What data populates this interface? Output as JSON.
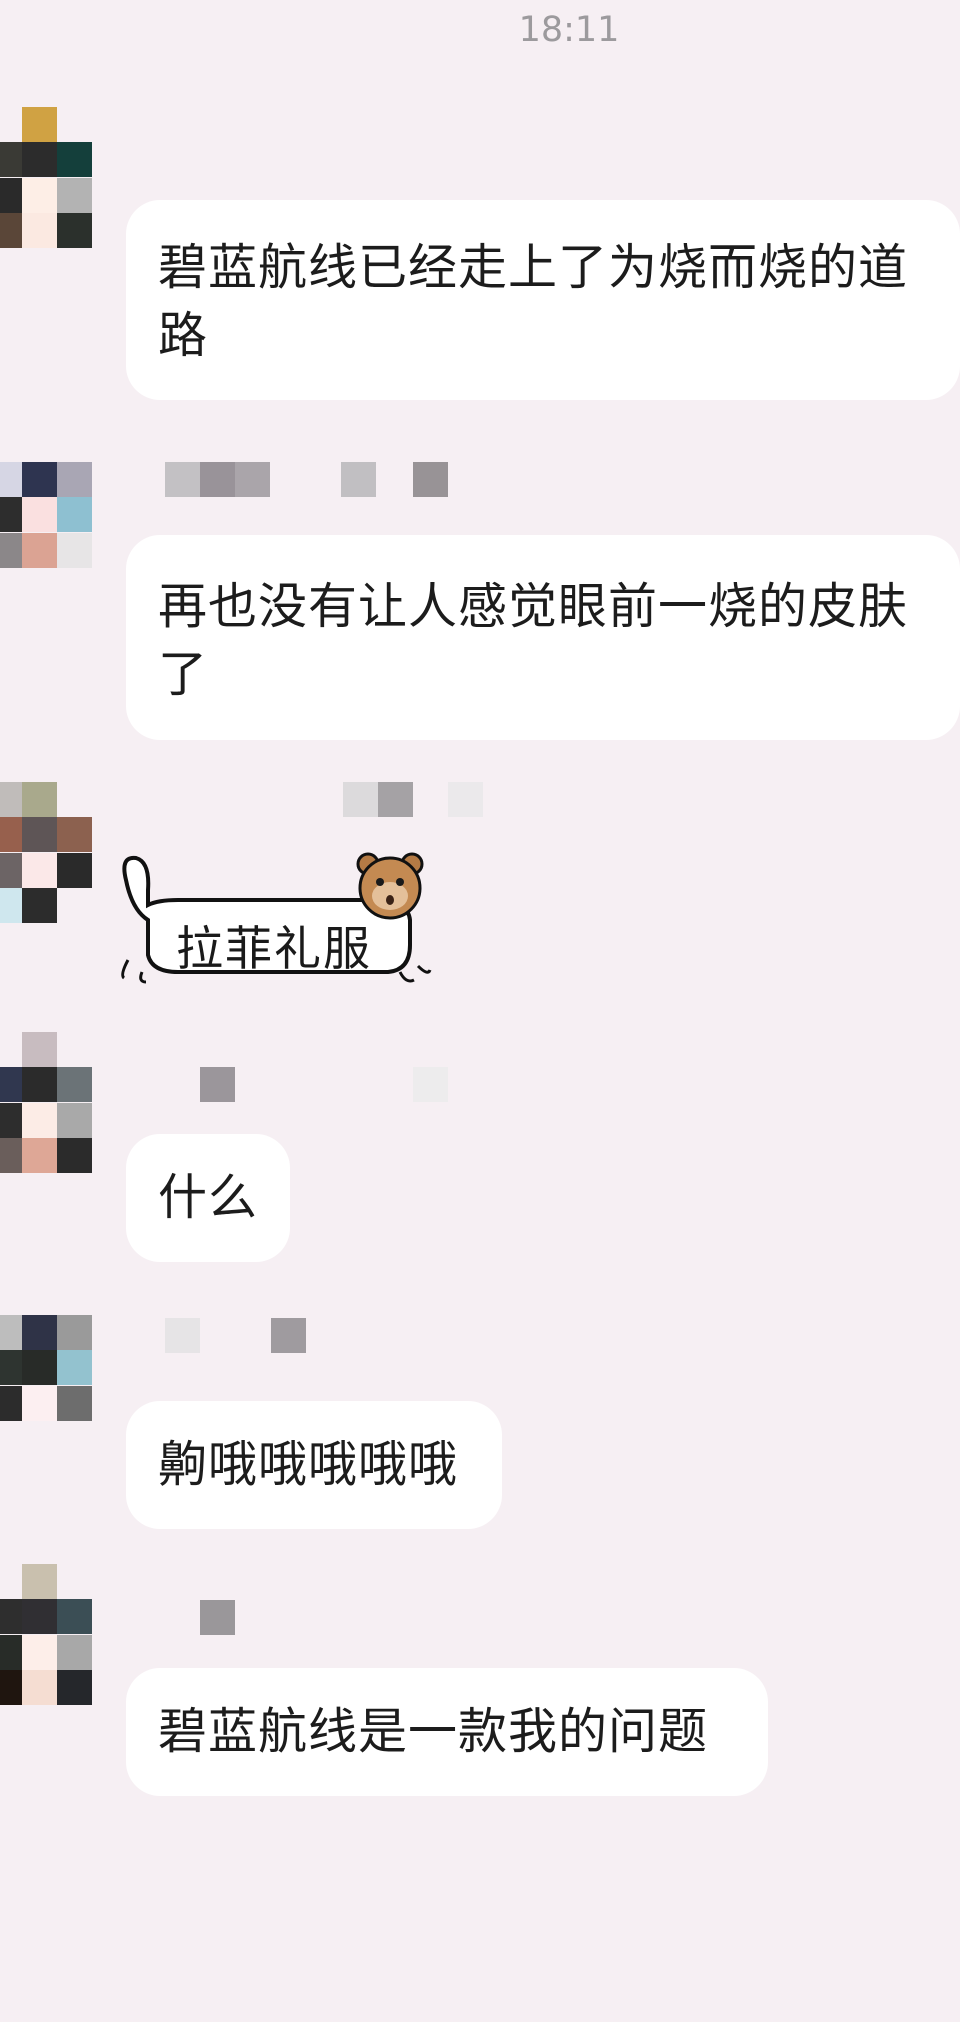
{
  "status_bar": {
    "time": "18:11"
  },
  "messages": [
    {
      "type": "text",
      "text": "碧蓝航线已经走上了为烧而烧的道\n路"
    },
    {
      "type": "text",
      "text": "再也没有让人感觉眼前一烧的皮肤\n了"
    },
    {
      "type": "sticker",
      "text": "拉菲礼服",
      "icon": "hamster-face-icon"
    },
    {
      "type": "text",
      "text": "什么"
    },
    {
      "type": "text",
      "text": "齁哦哦哦哦哦"
    },
    {
      "type": "text",
      "text": "碧蓝航线是一款我的问题"
    }
  ],
  "colors": {
    "background": "#f6eff3",
    "bubble": "#ffffff",
    "text": "#1c1c1c",
    "time": "#9c9a9d"
  }
}
